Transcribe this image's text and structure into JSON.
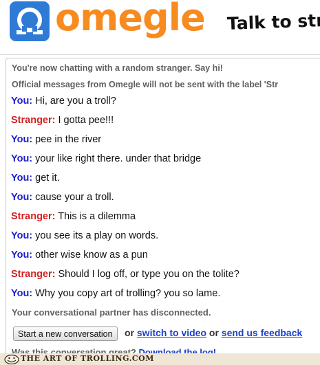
{
  "header": {
    "logo_text": "omegle",
    "tagline": "Talk to stra",
    "brand_blue": "#2e7bd6",
    "brand_orange": "#f78b1f"
  },
  "chat": {
    "system_top": [
      "You're now chatting with a random stranger. Say hi!",
      "Official messages from Omegle will not be sent with the label 'Str"
    ],
    "messages": [
      {
        "speaker": "You:",
        "text": "Hi, are you a troll?"
      },
      {
        "speaker": "Stranger:",
        "text": "I gotta pee!!!"
      },
      {
        "speaker": "You:",
        "text": "pee in the river"
      },
      {
        "speaker": "You:",
        "text": "your like right there. under that bridge"
      },
      {
        "speaker": "You:",
        "text": "get it."
      },
      {
        "speaker": "You:",
        "text": "cause your a troll."
      },
      {
        "speaker": "Stranger:",
        "text": "This is a dilemma"
      },
      {
        "speaker": "You:",
        "text": "you see its a play on words."
      },
      {
        "speaker": "You:",
        "text": "other wise know as a pun"
      },
      {
        "speaker": "Stranger:",
        "text": "Should I log off, or type you on the tolite?"
      },
      {
        "speaker": "You:",
        "text": "Why you copy art of trolling? you so lame."
      }
    ],
    "disconnected": "Your conversational partner has disconnected.",
    "you_color": "#1d1dcc",
    "stranger_color": "#d12020"
  },
  "controls": {
    "new_conversation": "Start a new conversation",
    "or1": "or",
    "switch_video": "switch to video",
    "or2": "or",
    "feedback": "send us feedback"
  },
  "rating": {
    "question": "Was this conversation great?",
    "download": "Download the log!"
  },
  "footer": {
    "watermark": "THE ART OF TROLLING.COM"
  }
}
